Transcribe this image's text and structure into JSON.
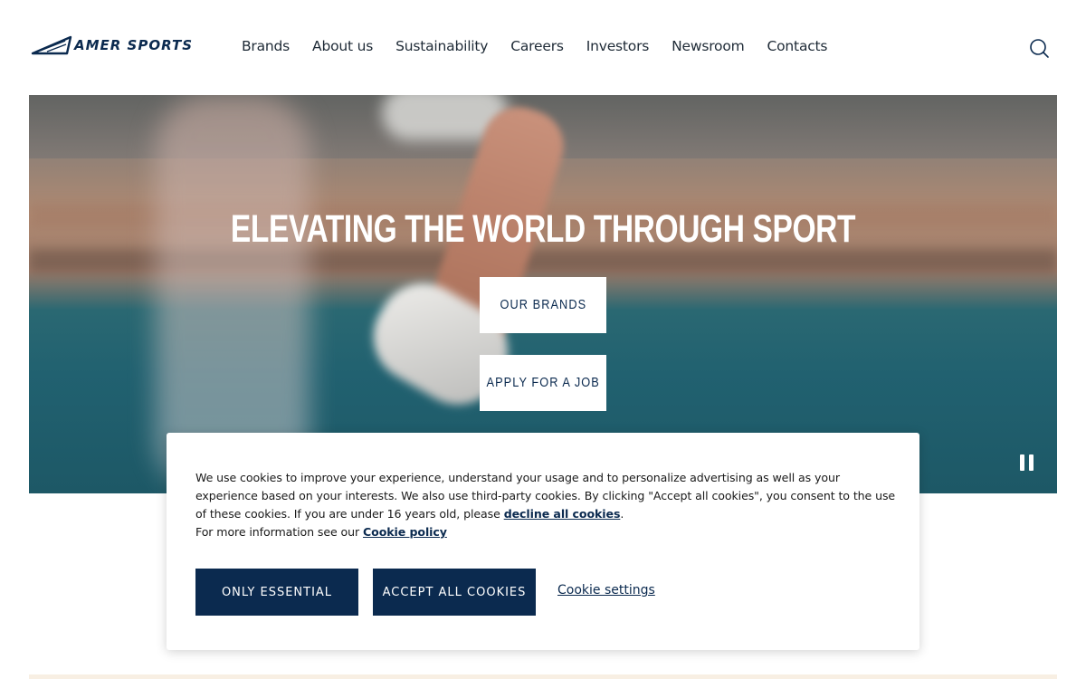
{
  "header": {
    "logo_text": "AMER SPORTS",
    "nav": [
      "Brands",
      "About us",
      "Sustainability",
      "Careers",
      "Investors",
      "Newsroom",
      "Contacts"
    ],
    "search_icon": "search-icon"
  },
  "hero": {
    "title": "ELEVATING THE WORLD THROUGH SPORT",
    "btn_brands": "OUR BRANDS",
    "btn_job": "APPLY FOR A JOB",
    "pause_icon": "pause-icon"
  },
  "cookie": {
    "text_1": "We use cookies to improve your experience, understand your usage and to personalize advertising as well as your experience based on your interests. We also use third-party cookies. By clicking \"Accept all cookies\", you consent to the use of these cookies. If you are under 16 years old, please ",
    "decline_link": "decline all cookies",
    "text_2": ".",
    "more_info": "For more information see our ",
    "policy_link": "Cookie policy",
    "btn_essential": "ONLY ESSENTIAL",
    "btn_accept": "ACCEPT ALL COOKIES",
    "settings_link": "Cookie settings"
  },
  "colors": {
    "brand_navy": "#0b2a4f",
    "strip": "#f8efe3"
  }
}
